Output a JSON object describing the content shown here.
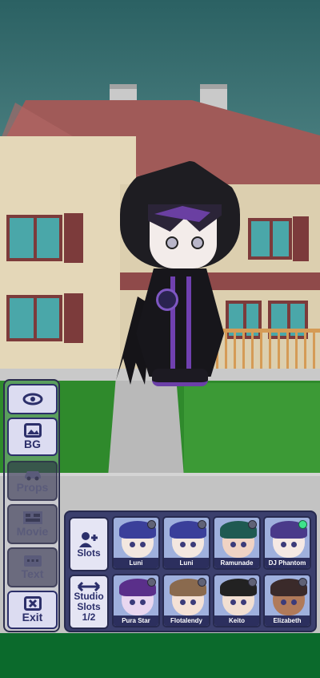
{
  "side_menu": {
    "items": [
      {
        "label": "",
        "icon": "eye-icon"
      },
      {
        "label": "BG",
        "icon": "image-icon"
      },
      {
        "label": "Props",
        "icon": "car-icon"
      },
      {
        "label": "Movie",
        "icon": "movie-icon"
      },
      {
        "label": "Text",
        "icon": "text-icon"
      },
      {
        "label": "Exit",
        "icon": "close-box-icon"
      }
    ]
  },
  "slot_panel": {
    "slots_button": "Slots",
    "studio_slots_button": "Studio Slots 1/2",
    "characters": [
      {
        "name": "Luni",
        "hair": "#3a3f9a",
        "skin": "#f3e7e0",
        "status": "inactive"
      },
      {
        "name": "Luni",
        "hair": "#3a3f9a",
        "skin": "#f3e7e0",
        "status": "inactive"
      },
      {
        "name": "Ramunade",
        "hair": "#1f5a52",
        "skin": "#f0d3c4",
        "status": "inactive"
      },
      {
        "name": "DJ Phantom",
        "hair": "#4a3a8a",
        "skin": "#f5e9e4",
        "status": "active"
      },
      {
        "name": "Pura Star",
        "hair": "#5a2f8a",
        "skin": "#e9d7f0",
        "status": "inactive"
      },
      {
        "name": "Flotalendy",
        "hair": "#8a6a4e",
        "skin": "#f4e1d6",
        "status": "inactive"
      },
      {
        "name": "Keito",
        "hair": "#222222",
        "skin": "#f1dfd2",
        "status": "inactive"
      },
      {
        "name": "Elizabeth",
        "hair": "#3a2a2a",
        "skin": "#b07a5a",
        "status": "inactive"
      }
    ]
  },
  "colors": {
    "panel_bg": "#3b3f6d",
    "button_bg": "#e5e5f4",
    "accent_text": "#2c2f6a",
    "active_dot": "#3ee38b"
  }
}
